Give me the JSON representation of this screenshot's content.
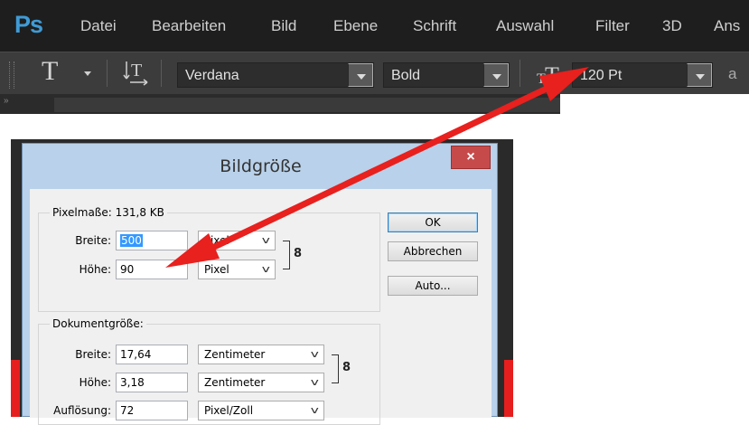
{
  "app": {
    "logo": "Ps",
    "menu": [
      "Datei",
      "Bearbeiten",
      "Bild",
      "Ebene",
      "Schrift",
      "Auswahl",
      "Filter",
      "3D",
      "Ans"
    ]
  },
  "options_bar": {
    "tool_glyph": "T",
    "font_family": "Verdana",
    "font_style": "Bold",
    "font_size": "120 Pt",
    "antialias_glyph": "a"
  },
  "dialog": {
    "title": "Bildgröße",
    "close_glyph": "×",
    "pixel_dims": {
      "legend": "Pixelmaße: 131,8 KB",
      "width_label": "Breite:",
      "width_value": "500",
      "width_unit": "Pixel",
      "height_label": "Höhe:",
      "height_value": "90",
      "height_unit": "Pixel"
    },
    "doc_size": {
      "legend": "Dokumentgröße:",
      "width_label": "Breite:",
      "width_value": "17,64",
      "width_unit": "Zentimeter",
      "height_label": "Höhe:",
      "height_value": "3,18",
      "height_unit": "Zentimeter",
      "res_label": "Auflösung:",
      "res_value": "72",
      "res_unit": "Pixel/Zoll"
    },
    "buttons": {
      "ok": "OK",
      "cancel": "Abbrechen",
      "auto": "Auto..."
    }
  },
  "colors": {
    "annotation_arrow": "#e8201e",
    "ps_blue": "#3f9bd6"
  }
}
